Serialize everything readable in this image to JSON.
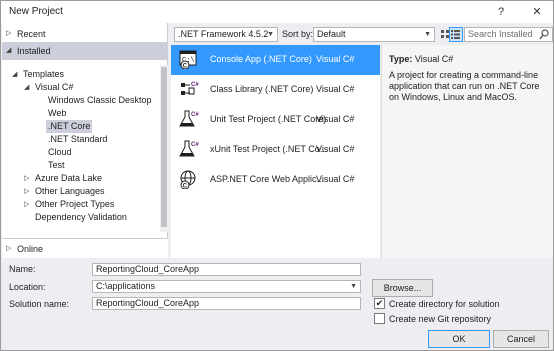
{
  "window": {
    "title": "New Project",
    "help": "?",
    "close": "✕"
  },
  "left": {
    "recent": "Recent",
    "installed": "Installed",
    "online": "Online",
    "tree": [
      {
        "label": "Templates",
        "arrow": "◢"
      },
      {
        "label": "Visual C#",
        "arrow": "◢"
      },
      {
        "label": "Windows Classic Desktop"
      },
      {
        "label": "Web"
      },
      {
        "label": ".NET Core"
      },
      {
        "label": ".NET Standard"
      },
      {
        "label": "Cloud"
      },
      {
        "label": "Test"
      },
      {
        "label": "Azure Data Lake",
        "arrow": "▷"
      },
      {
        "label": "Other Languages",
        "arrow": "▷"
      },
      {
        "label": "Other Project Types",
        "arrow": "▷"
      },
      {
        "label": "Dependency Validation"
      }
    ]
  },
  "toolbar": {
    "framework": ".NET Framework 4.5.2",
    "sort_label": "Sort by:",
    "sort_value": "Default",
    "search_placeholder": "Search Installed"
  },
  "templates": [
    {
      "name": "Console App (.NET Core)",
      "lang": "Visual C#",
      "selected": true,
      "icon": "console-app-icon"
    },
    {
      "name": "Class Library (.NET Core)",
      "lang": "Visual C#",
      "icon": "class-library-icon"
    },
    {
      "name": "Unit Test Project (.NET Core)",
      "lang": "Visual C#",
      "icon": "unit-test-icon"
    },
    {
      "name": "xUnit Test Project (.NET Co...",
      "lang": "Visual C#",
      "icon": "xunit-test-icon"
    },
    {
      "name": "ASP.NET Core Web Applic...",
      "lang": "Visual C#",
      "icon": "aspnet-web-icon"
    }
  ],
  "details": {
    "type_label": "Type:",
    "type_value": "Visual C#",
    "description": "A project for creating a command-line application that can run on .NET Core on Windows, Linux and MacOS."
  },
  "form": {
    "name_label": "Name:",
    "name_value": "ReportingCloud_CoreApp",
    "location_label": "Location:",
    "location_value": "C:\\applications",
    "solution_label": "Solution name:",
    "solution_value": "ReportingCloud_CoreApp",
    "browse": "Browse...",
    "create_dir": "Create directory for solution",
    "create_dir_checked": "✔",
    "create_git": "Create new Git repository",
    "ok": "OK",
    "cancel": "Cancel"
  },
  "colors": {
    "selection": "#3399ff",
    "tree_selection": "#cccedb"
  }
}
